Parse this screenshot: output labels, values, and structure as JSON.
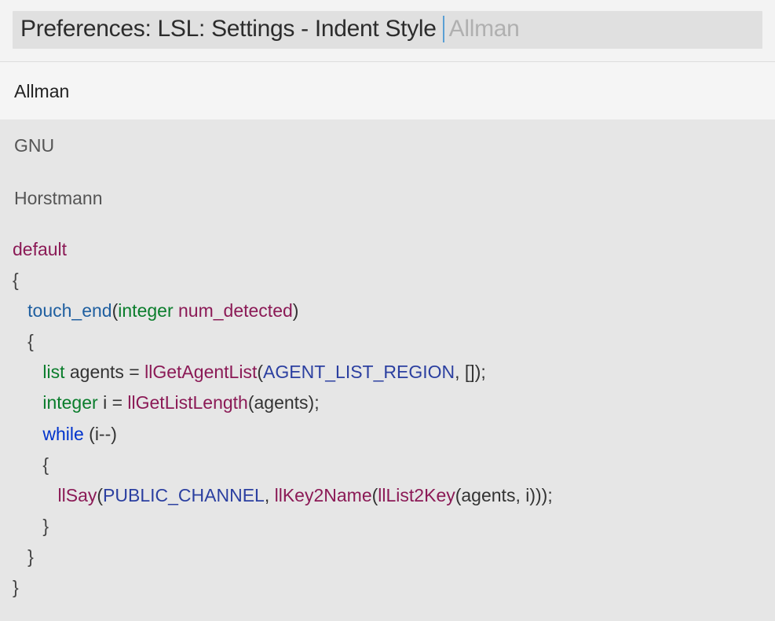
{
  "header": {
    "breadcrumb": "Preferences: LSL: Settings - Indent Style",
    "current_value": "Allman"
  },
  "options": [
    {
      "label": "Allman",
      "selected": true
    },
    {
      "label": "GNU",
      "selected": false
    },
    {
      "label": "Horstmann",
      "selected": false
    }
  ],
  "code": {
    "state": "default",
    "event": "touch_end",
    "event_param_type": "integer",
    "event_param_name": "num_detected",
    "l1_type": "list",
    "l1_var": "agents",
    "l1_func": "llGetAgentList",
    "l1_const": "AGENT_LIST_REGION",
    "l1_tail": ", []);",
    "l2_type": "integer",
    "l2_var": "i",
    "l2_func": "llGetListLength",
    "l2_tail": "(agents);",
    "l3_ctrl": "while",
    "l3_cond": " (i--)",
    "l4_func1": "llSay",
    "l4_const": "PUBLIC_CHANNEL",
    "l4_func2": "llKey2Name",
    "l4_func3": "llList2Key",
    "l4_tail": "(agents, i)));"
  }
}
